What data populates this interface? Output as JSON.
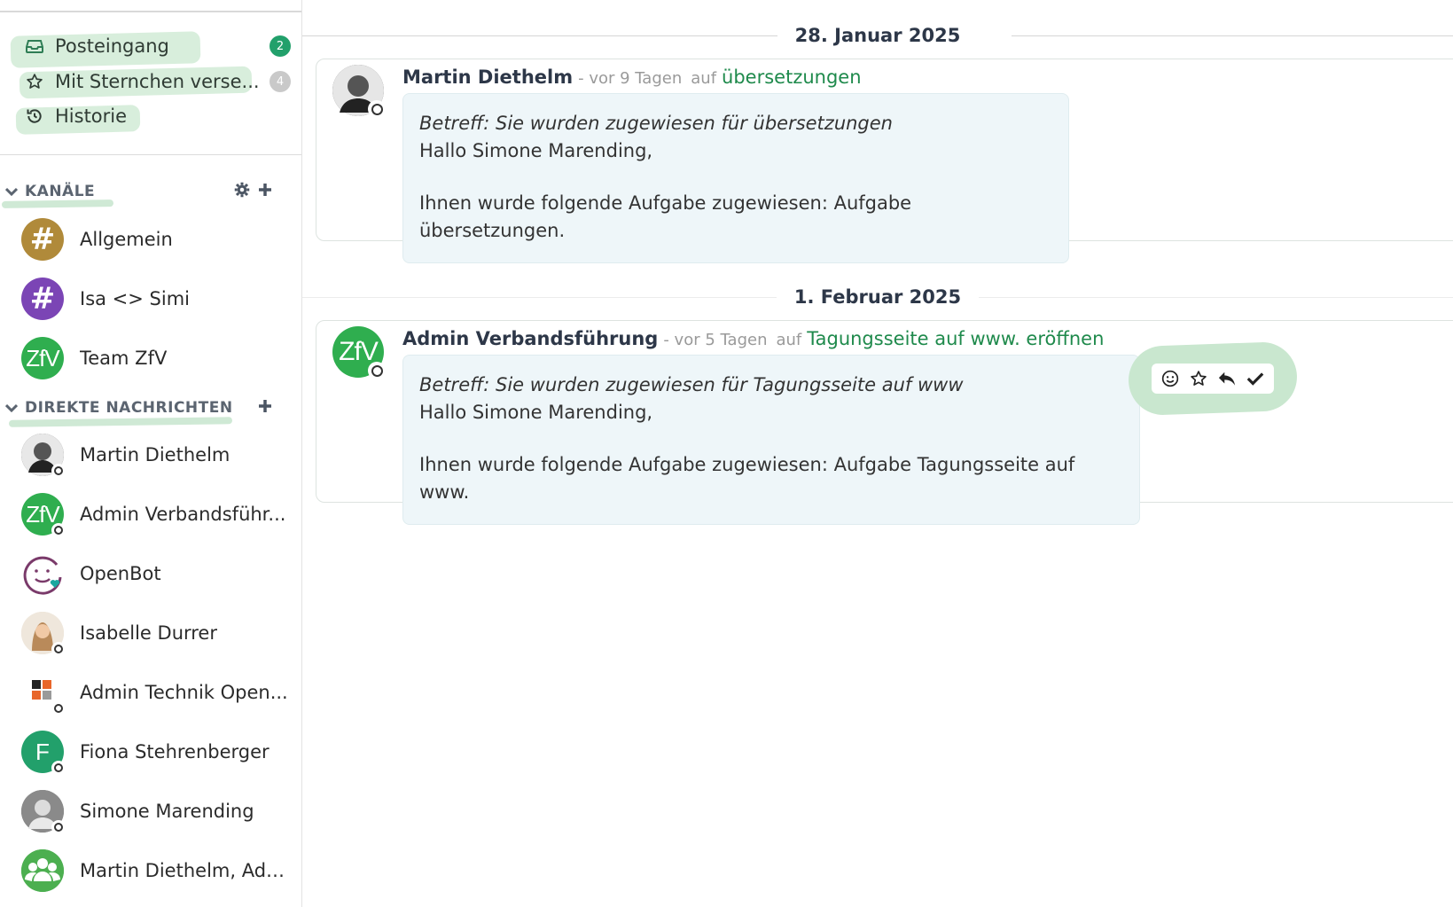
{
  "sidebar": {
    "nav": [
      {
        "label": "Posteingang",
        "icon": "inbox-icon",
        "count": "2",
        "count_color": "#22a06b"
      },
      {
        "label": "Mit Sternchen verse...",
        "icon": "star-icon",
        "count": "4",
        "count_color": "#c9c9c9"
      },
      {
        "label": "Historie",
        "icon": "history-icon"
      }
    ],
    "channels_header": "KANÄLE",
    "channels": [
      {
        "label": "Allgemein",
        "color": "#b08a3a",
        "icon": "hash-icon"
      },
      {
        "label": "Isa <> Simi",
        "color": "#7b45b5",
        "icon": "hash-icon"
      },
      {
        "label": "Team ZfV",
        "color": "#2fae4f",
        "icon": "zfv-logo"
      }
    ],
    "dm_header": "DIREKTE NACHRICHTEN",
    "direct_messages": [
      {
        "label": "Martin Diethelm",
        "color": "#3a3a3a"
      },
      {
        "label": "Admin Verbandsführ...",
        "color": "#2fae4f",
        "avatar_text": "ZfV"
      },
      {
        "label": "OpenBot",
        "color": "#ffffff"
      },
      {
        "label": "Isabelle Durrer",
        "color": "#d9c3a8"
      },
      {
        "label": "Admin Technik Open...",
        "color": "#ffffff"
      },
      {
        "label": "Fiona Stehrenberger",
        "color": "#22a06b",
        "avatar_text": "F"
      },
      {
        "label": "Simone Marending",
        "color": "#7a7a7a"
      },
      {
        "label": "Martin Diethelm, Adm...",
        "color": "#4caf50"
      }
    ]
  },
  "main": {
    "groups": [
      {
        "date": "28. Januar 2025",
        "message": {
          "author": "Martin Diethelm",
          "time": "- vor 9 Tagen",
          "auf": "auf",
          "topic": "übersetzungen",
          "subject": "Betreff: Sie wurden zugewiesen für übersetzungen",
          "greeting": "Hallo Simone Marending,",
          "body": "Ihnen wurde folgende Aufgabe zugewiesen: Aufgabe übersetzungen."
        }
      },
      {
        "date": "1. Februar 2025",
        "message": {
          "author": "Admin Verbandsführung",
          "time": "- vor 5 Tagen",
          "auf": "auf",
          "topic": "Tagungsseite auf www. eröffnen",
          "subject": "Betreff: Sie wurden zugewiesen für Tagungsseite auf www",
          "greeting": "Hallo Simone Marending,",
          "body": "Ihnen wurde folgende Aufgabe zugewiesen: Aufgabe Tagungsseite auf www.",
          "avatar_text": "ZfV"
        }
      }
    ],
    "message_actions": [
      "emoji-icon",
      "star-icon",
      "reply-icon",
      "check-icon"
    ]
  }
}
